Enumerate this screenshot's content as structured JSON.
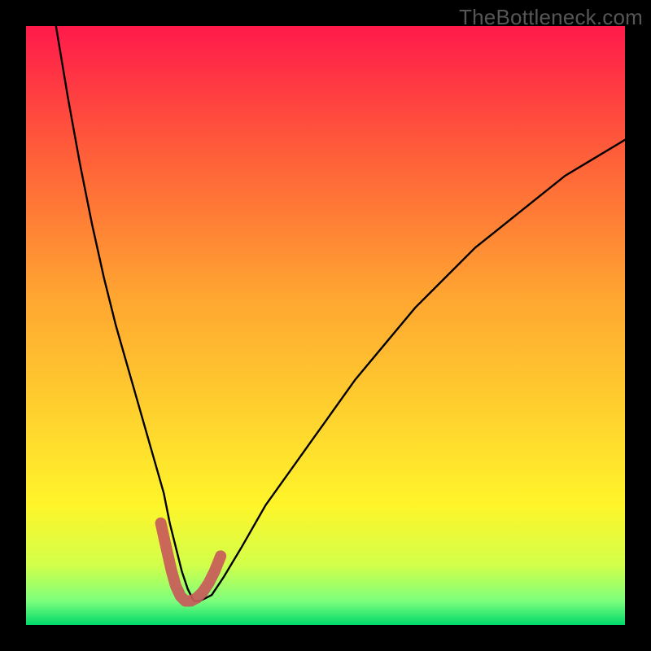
{
  "watermark": "TheBottleneck.com",
  "chart_data": {
    "type": "line",
    "title": "",
    "xlabel": "",
    "ylabel": "",
    "xlim": [
      0,
      100
    ],
    "ylim": [
      0,
      100
    ],
    "gradient_stops": [
      {
        "offset": 0.0,
        "color": "#ff1a4b"
      },
      {
        "offset": 0.2,
        "color": "#ff5a3a"
      },
      {
        "offset": 0.45,
        "color": "#ffa531"
      },
      {
        "offset": 0.65,
        "color": "#ffd22e"
      },
      {
        "offset": 0.8,
        "color": "#fff52a"
      },
      {
        "offset": 0.9,
        "color": "#d2ff4a"
      },
      {
        "offset": 0.96,
        "color": "#7dff7d"
      },
      {
        "offset": 1.0,
        "color": "#00d96b"
      }
    ],
    "series": [
      {
        "name": "bottleneck-curve",
        "stroke": "#000000",
        "stroke_width": 2.4,
        "x": [
          5,
          7,
          9,
          11,
          13,
          15,
          17,
          19,
          21,
          23,
          24,
          25,
          26,
          27,
          28,
          29,
          31,
          33,
          36,
          40,
          45,
          50,
          55,
          60,
          65,
          70,
          75,
          80,
          85,
          90,
          95,
          100
        ],
        "y": [
          100,
          88,
          77,
          67,
          58,
          50,
          43,
          36,
          29,
          22,
          17,
          13,
          9,
          6,
          4,
          4,
          5,
          8,
          13,
          20,
          27,
          34,
          41,
          47,
          53,
          58,
          63,
          67,
          71,
          75,
          78,
          81
        ]
      }
    ],
    "marker_series": {
      "name": "bottleneck-markers",
      "stroke": "#c85a5a",
      "stroke_width": 14,
      "linecap": "round",
      "x": [
        22.5,
        23.5,
        24.3,
        25.0,
        25.8,
        26.6,
        27.5,
        28.5,
        29.5,
        30.5,
        31.5,
        32.5
      ],
      "y": [
        17.0,
        12.5,
        9.0,
        6.5,
        4.8,
        4.0,
        4.0,
        4.5,
        5.5,
        7.0,
        9.0,
        11.5
      ]
    }
  }
}
